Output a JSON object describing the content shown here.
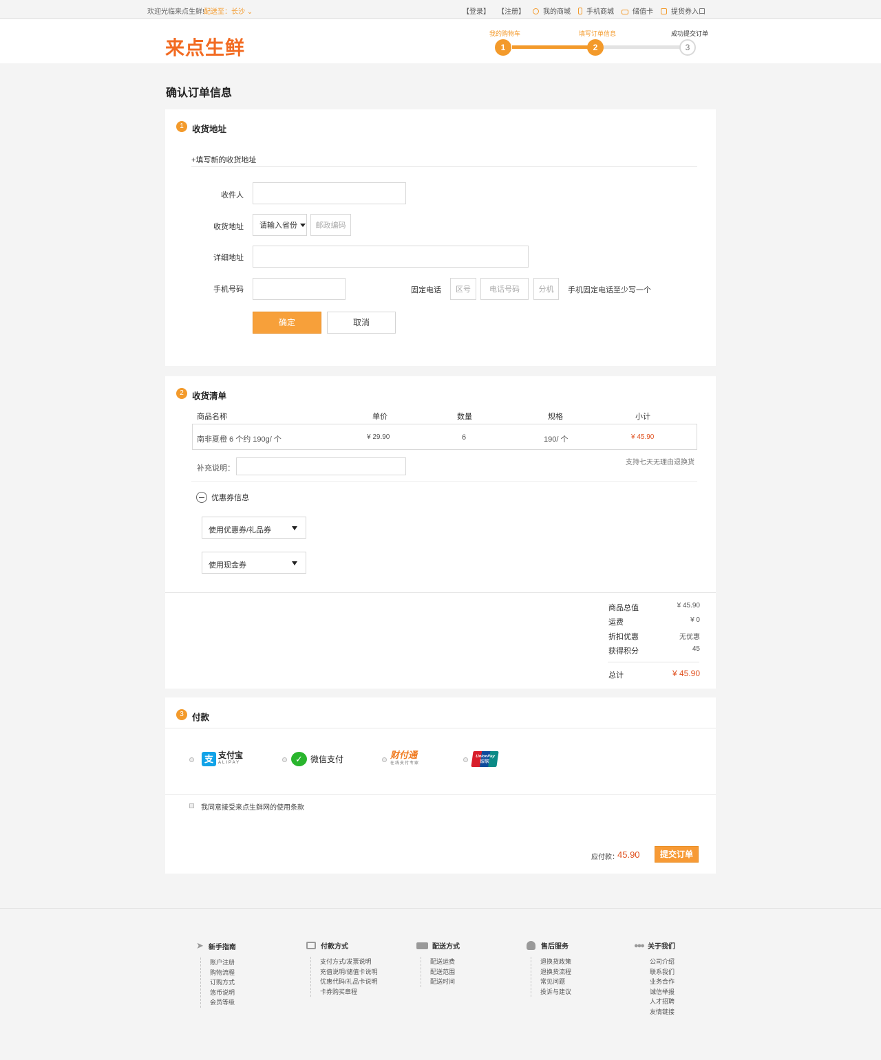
{
  "topbar": {
    "welcome": "欢迎光临来点生鲜!",
    "deliver_to": "配送至：长沙",
    "login": "【登录】",
    "register": "【注册】",
    "my_mall": "我的商城",
    "mobile_mall": "手机商城",
    "stored_card": "储值卡",
    "voucher_entry": "提货券入口"
  },
  "header": {
    "logo": "来点生鲜",
    "steps": [
      {
        "label": "我的购物车",
        "num": "1",
        "state": "done"
      },
      {
        "label": "填写订单信息",
        "num": "2",
        "state": "active"
      },
      {
        "label": "成功提交订单",
        "num": "3",
        "state": "todo"
      }
    ]
  },
  "page_title": "确认订单信息",
  "address": {
    "num": "1",
    "title": "收货地址",
    "add_new": "+填写新的收货地址",
    "recipient_label": "收件人",
    "region_label": "收货地址",
    "province_placeholder": "请输入省份",
    "postcode_placeholder": "邮政编码",
    "detail_label": "详细地址",
    "mobile_label": "手机号码",
    "phone_label": "固定电话",
    "area_code_placeholder": "区号",
    "phone_placeholder": "电话号码",
    "ext_placeholder": "分机",
    "phone_hint": "手机固定电话至少写一个",
    "confirm": "确定",
    "cancel": "取消"
  },
  "order": {
    "num": "2",
    "title": "收货清单",
    "headers": [
      "商品名称",
      "单价",
      "数量",
      "规格",
      "小计"
    ],
    "rows": [
      {
        "name": "南非夏橙 6 个约 190g/ 个",
        "price": "¥ 29.90",
        "qty": "6",
        "spec": "190/ 个",
        "subtotal": "¥ 45.90"
      }
    ],
    "remark_label": "补充说明：",
    "return_policy": "支持七天无理由退换货",
    "coupon_toggle": "优惠券信息",
    "coupon_select": "使用优惠券/礼品券",
    "cash_select": "使用现金券"
  },
  "summary": {
    "items": [
      {
        "label": "商品总值",
        "value": "¥ 45.90"
      },
      {
        "label": "运费",
        "value": "¥ 0"
      },
      {
        "label": "折扣优惠",
        "value": "无优惠"
      },
      {
        "label": "获得积分",
        "value": "45"
      }
    ],
    "total_label": "总计",
    "total_value": "¥ 45.90"
  },
  "payment": {
    "num": "3",
    "title": "付款",
    "methods": [
      {
        "name": "支付宝",
        "sub": "ALIPAY"
      },
      {
        "name": "微信支付"
      },
      {
        "name": "财付通",
        "sub": "在线支付专家"
      },
      {
        "name": "UnionPay",
        "sub": "银联"
      }
    ],
    "terms": "我同意接受来点生鲜网的使用条款",
    "payable_label": "应付款：",
    "payable_value": "45.90",
    "submit": "提交订单"
  },
  "footer": {
    "columns": [
      {
        "title": "新手指南",
        "items": [
          "账户注册",
          "购物流程",
          "订购方式",
          "悠币说明",
          "会员等级"
        ]
      },
      {
        "title": "付款方式",
        "items": [
          "支付方式/发票说明",
          "充值说明/储值卡说明",
          "优惠代码/礼品卡说明",
          "卡券购买章程"
        ]
      },
      {
        "title": "配送方式",
        "items": [
          "配送运费",
          "配送范围",
          "配送时间"
        ]
      },
      {
        "title": "售后服务",
        "items": [
          "退换货政策",
          "退换货流程",
          "常见问题",
          "投诉与建议"
        ]
      },
      {
        "title": "关于我们",
        "items": [
          "公司介绍",
          "联系我们",
          "业务合作",
          "诚信举报",
          "人才招聘",
          "友情链接"
        ]
      }
    ]
  },
  "colors": {
    "accent": "#f39a2b",
    "logo": "#f26b22",
    "price": "#e0511f"
  }
}
